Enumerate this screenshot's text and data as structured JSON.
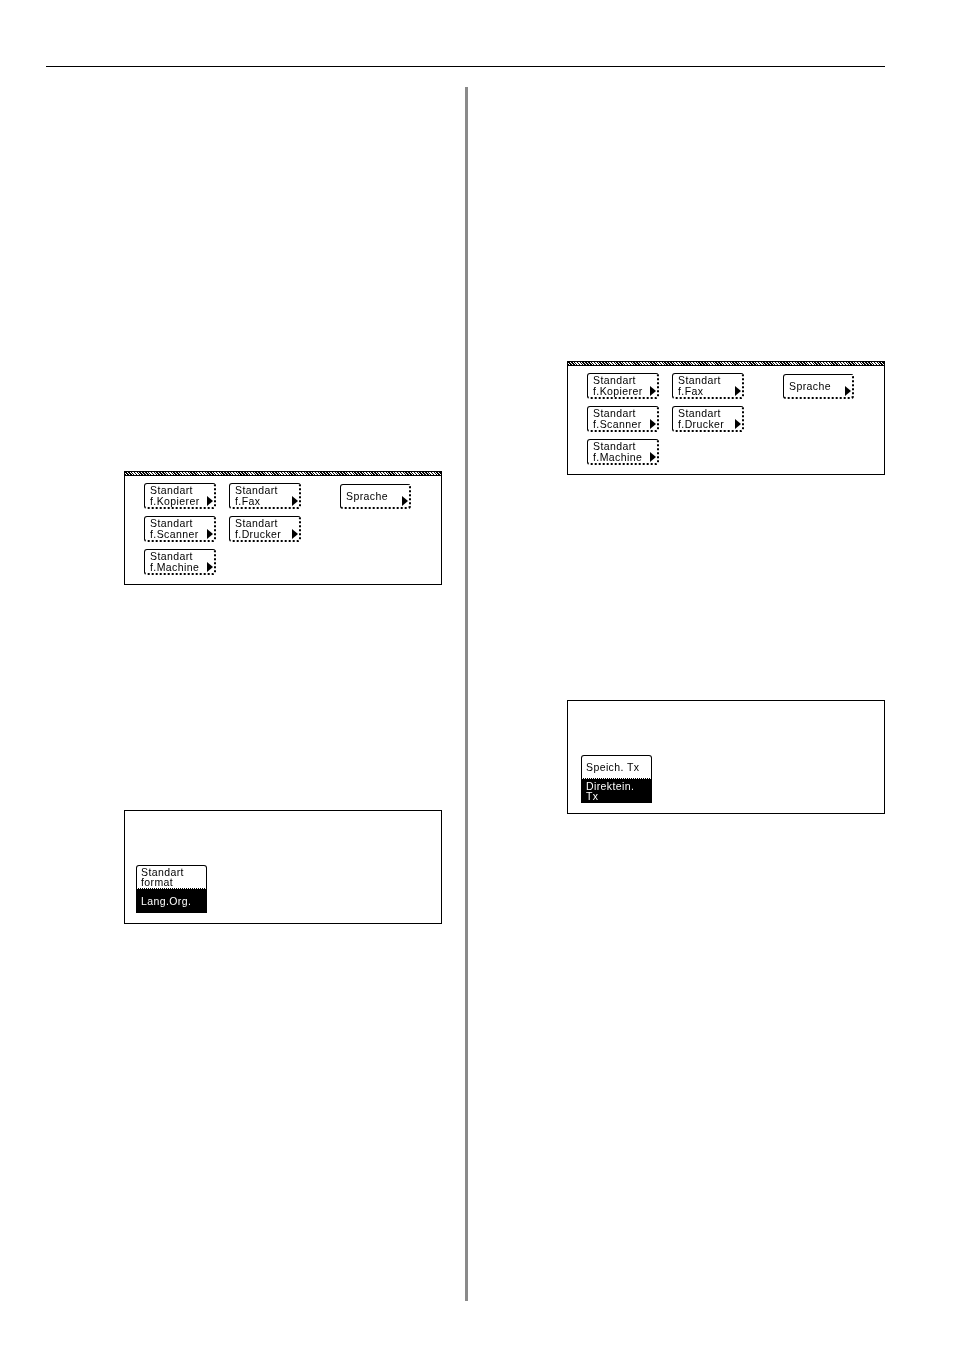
{
  "left_column": {
    "panels": [
      {
        "kind": "menu",
        "buttons": [
          {
            "label": "Standart\nf.Kopierer"
          },
          {
            "label": "Standart\nf.Fax"
          },
          {
            "label": "Standart\nf.Scanner"
          },
          {
            "label": "Standart\nf.Drucker"
          },
          {
            "label": "Standart\nf.Machine"
          }
        ],
        "side_button": {
          "label": "Sprache"
        }
      },
      {
        "kind": "options",
        "options": [
          {
            "label": "Standart\nformat",
            "selected": false
          },
          {
            "label": "Lang.Org.",
            "selected": true
          }
        ]
      }
    ]
  },
  "right_column": {
    "panels": [
      {
        "kind": "menu",
        "buttons": [
          {
            "label": "Standart\nf.Kopierer"
          },
          {
            "label": "Standart\nf.Fax"
          },
          {
            "label": "Standart\nf.Scanner"
          },
          {
            "label": "Standart\nf.Drucker"
          },
          {
            "label": "Standart\nf.Machine"
          }
        ],
        "side_button": {
          "label": "Sprache"
        }
      },
      {
        "kind": "options",
        "options": [
          {
            "label": "Speich. Tx",
            "selected": false
          },
          {
            "label": "Direktein.\nTx",
            "selected": true
          }
        ]
      }
    ]
  }
}
